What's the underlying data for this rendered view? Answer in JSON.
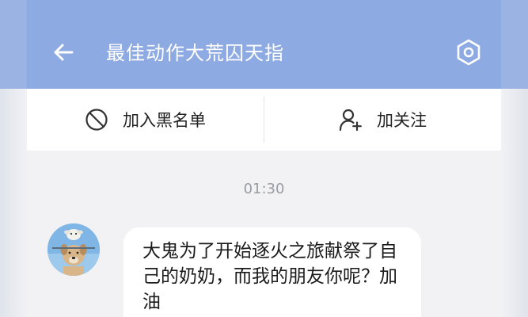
{
  "header": {
    "title": "最佳动作大荒囚天指"
  },
  "actions": {
    "block_label": "加入黑名单",
    "follow_label": "加关注"
  },
  "chat": {
    "timestamp": "01:30",
    "messages": [
      {
        "text": "大鬼为了开始逐火之旅献祭了自己的奶奶，而我的朋友你呢？加油"
      }
    ]
  },
  "colors": {
    "header_bg": "#8eaae2",
    "page_bg": "#f2f2f4",
    "bubble_bg": "#ffffff",
    "timestamp_text": "#9a9ca3"
  },
  "icons": {
    "back": "arrow-left-icon",
    "settings": "hexagon-gear-icon",
    "block": "prohibit-icon",
    "follow": "add-user-icon"
  }
}
